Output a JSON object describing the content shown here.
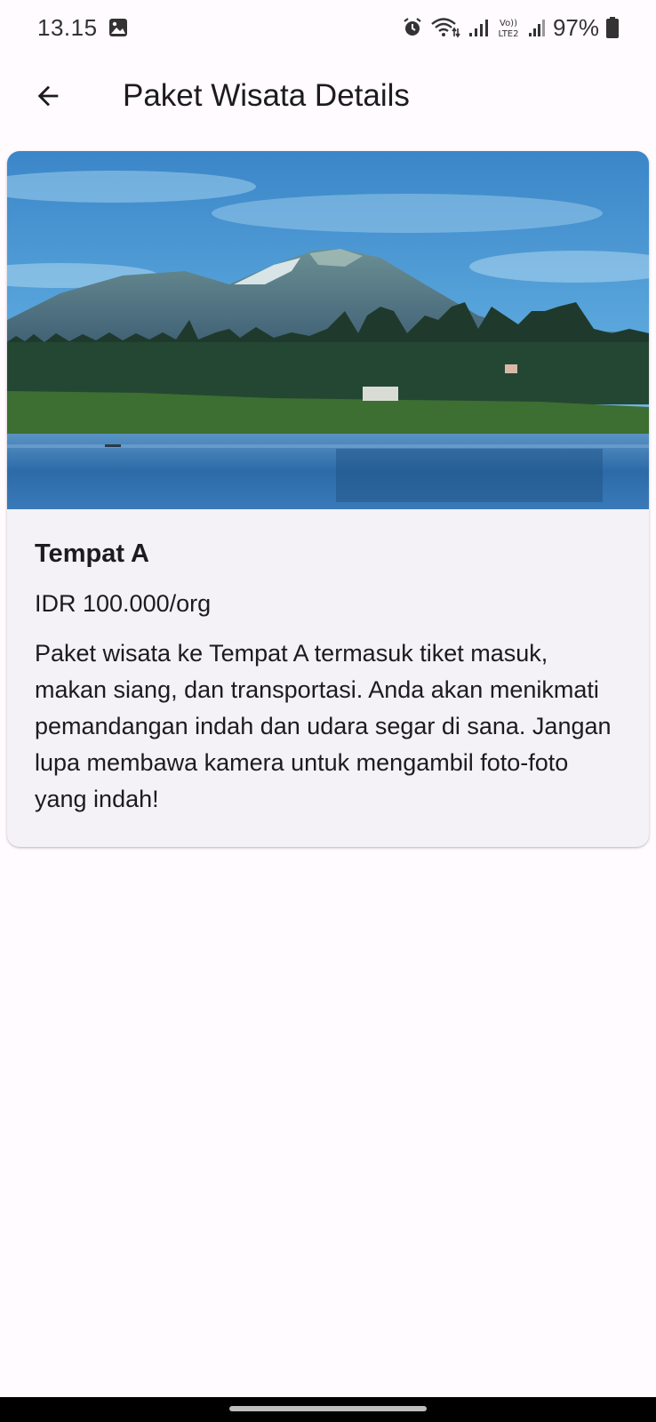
{
  "status_bar": {
    "time": "13.15",
    "battery": "97%",
    "icons": [
      "gallery-icon",
      "alarm-icon",
      "wifi-icon",
      "signal-icon",
      "volte-icon",
      "battery-icon"
    ]
  },
  "app_bar": {
    "title": "Paket Wisata Details",
    "back_icon": "arrow-back-icon"
  },
  "card": {
    "title": "Tempat A",
    "price": "IDR 100.000/org",
    "description": "Paket wisata ke Tempat A termasuk tiket masuk, makan siang, dan transportasi. Anda akan menikmati pemandangan indah dan udara segar di sana. Jangan lupa membawa kamera untuk mengambil foto-foto yang indah!",
    "image": "lake-mountain-photo"
  },
  "colors": {
    "background": "#fffbfe",
    "card": "#f4f1f7",
    "text": "#1c1b1f",
    "sky": "#3a8fd0",
    "lake": "#2e6fb0"
  }
}
